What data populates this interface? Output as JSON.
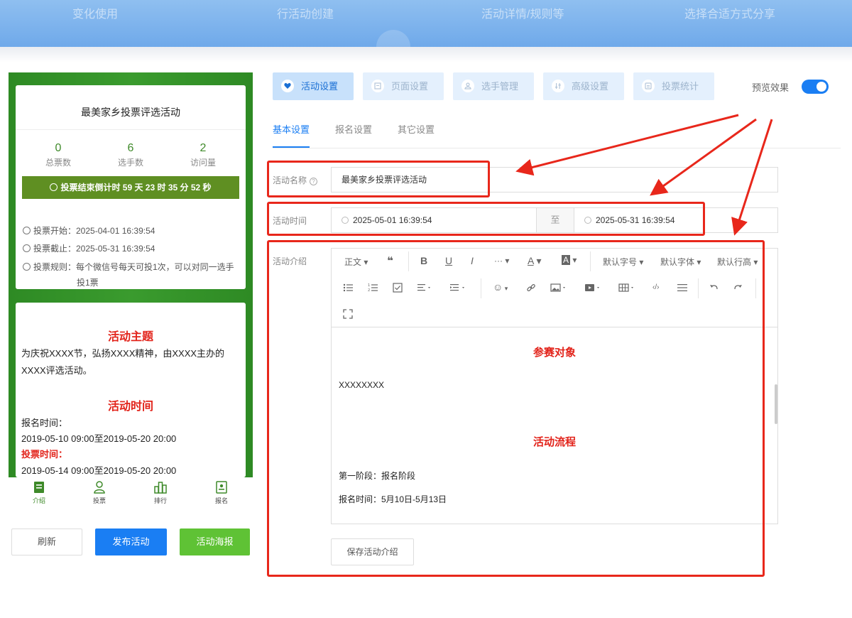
{
  "banner": {
    "items": [
      "变化使用",
      "行活动创建",
      "活动详情/规则等",
      "选择合适方式分享"
    ]
  },
  "preview": {
    "title": "最美家乡投票评选活动",
    "stats": [
      {
        "value": "0",
        "label": "总票数"
      },
      {
        "value": "6",
        "label": "选手数"
      },
      {
        "value": "2",
        "label": "访问量"
      }
    ],
    "countdown": "投票结束倒计时 59 天 23 时 35 分 52 秒",
    "vote_start": "投票开始：2025-04-01 16:39:54",
    "vote_end": "投票截止：2025-05-31 16:39:54",
    "rule_line1": "投票规则：每个微信号每天可投1次，可以对同一选手",
    "rule_line2": "投1票",
    "theme_title": "活动主题",
    "theme_text": "为庆祝XXXX节，弘扬XXXX精神，由XXXX主办的XXXX评选活动。",
    "time_title": "活动时间",
    "signup_time_label": "报名时间：",
    "signup_time_value": "2019-05-10 09:00至2019-05-20 20:00",
    "vote_time_label": "投票时间：",
    "vote_time_value": "2019-05-14 09:00至2019-05-20 20:00",
    "tabbar": [
      "介绍",
      "投票",
      "排行",
      "报名"
    ]
  },
  "actions": {
    "refresh": "刷新",
    "publish": "发布活动",
    "poster": "活动海报"
  },
  "top_tabs": [
    "活动设置",
    "页面设置",
    "选手管理",
    "高级设置",
    "投票统计"
  ],
  "preview_toggle": {
    "label": "预览效果",
    "on": true
  },
  "sub_tabs": [
    "基本设置",
    "报名设置",
    "其它设置"
  ],
  "form": {
    "name_label": "活动名称",
    "name_value": "最美家乡投票评选活动",
    "time_label": "活动时间",
    "time_start": "2025-05-01 16:39:54",
    "time_sep": "至",
    "time_end": "2025-05-31 16:39:54",
    "intro_label": "活动介绍"
  },
  "editor": {
    "toolbar": {
      "paragraph": "正文",
      "font_size": "默认字号",
      "font_family": "默认字体",
      "line_height": "默认行高",
      "quote": "❝",
      "bold": "B",
      "underline": "U",
      "italic": "I",
      "more": "···",
      "font_color": "A",
      "bg_color": "A",
      "emoji": "☺",
      "code": "‹/›"
    },
    "content": {
      "heading1": "参赛对象",
      "text1": "XXXXXXXX",
      "heading2": "活动流程",
      "text2": "第一阶段：报名阶段",
      "text3": "报名时间：5月10日-5月13日"
    }
  },
  "save_button": "保存活动介绍",
  "colors": {
    "accent": "#1a7ef3",
    "annotation": "#e8271b",
    "preview_green": "#3a9b2e",
    "poster_button": "#5fc235"
  }
}
